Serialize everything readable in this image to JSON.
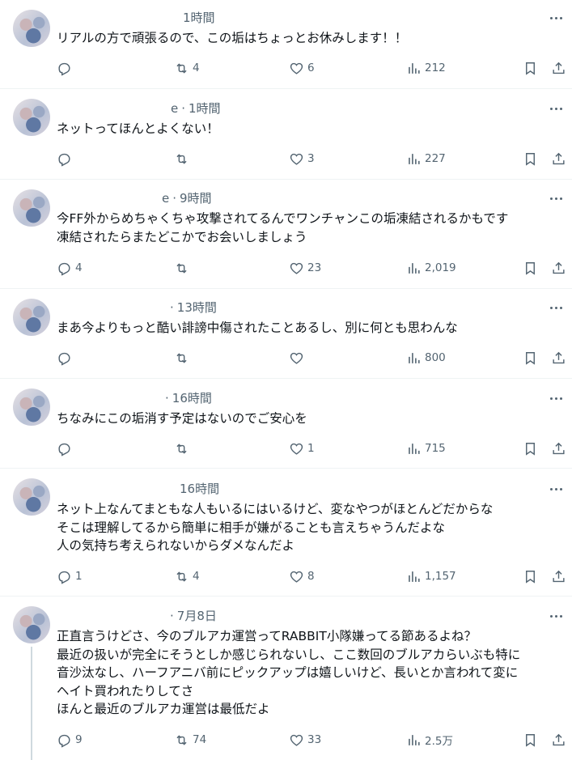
{
  "tweets": [
    {
      "time": "1時間",
      "handle": "",
      "text": "リアルの方で頑張るので、この垢はちょっとお休みします！！",
      "replies": "",
      "retweets": "4",
      "likes": "6",
      "views": "212"
    },
    {
      "time": "1時間",
      "handle": "e",
      "text": "ネットってほんとよくない！",
      "replies": "",
      "retweets": "",
      "likes": "3",
      "views": "227"
    },
    {
      "time": "9時間",
      "handle": "e",
      "text": "今FF外からめちゃくちゃ攻撃されてるんでワンチャンこの垢凍結されるかもです\n凍結されたらまたどこかでお会いしましょう",
      "replies": "4",
      "retweets": "",
      "likes": "23",
      "views": "2,019"
    },
    {
      "time": "13時間",
      "handle": "",
      "text": "まあ今よりもっと酷い誹謗中傷されたことあるし、別に何とも思わんな",
      "replies": "",
      "retweets": "",
      "likes": "",
      "views": "800"
    },
    {
      "time": "16時間",
      "handle": "",
      "text": "ちなみにこの垢消す予定はないのでご安心を",
      "replies": "",
      "retweets": "",
      "likes": "1",
      "views": "715"
    },
    {
      "time": "16時間",
      "handle": "",
      "text": "ネット上なんてまともな人もいるにはいるけど、変なやつがほとんどだからな\nそこは理解してるから簡単に相手が嫌がることも言えちゃうんだよな\n人の気持ち考えられないからダメなんだよ",
      "replies": "1",
      "retweets": "4",
      "likes": "8",
      "views": "1,157"
    },
    {
      "time": "7月8日",
      "handle": "",
      "text": "正直言うけどさ、今のブルアカ運営ってRABBIT小隊嫌ってる節あるよね？\n最近の扱いが完全にそうとしか感じられないし、ここ数回のブルアカらいぶも特に\n音沙汰なし、ハーフアニバ前にピックアップは嬉しいけど、長いとか言われて変に\nヘイト買われたりしてさ\nほんと最近のブルアカ運営は最低だよ",
      "replies": "9",
      "retweets": "74",
      "likes": "33",
      "views": "2.5万"
    }
  ]
}
